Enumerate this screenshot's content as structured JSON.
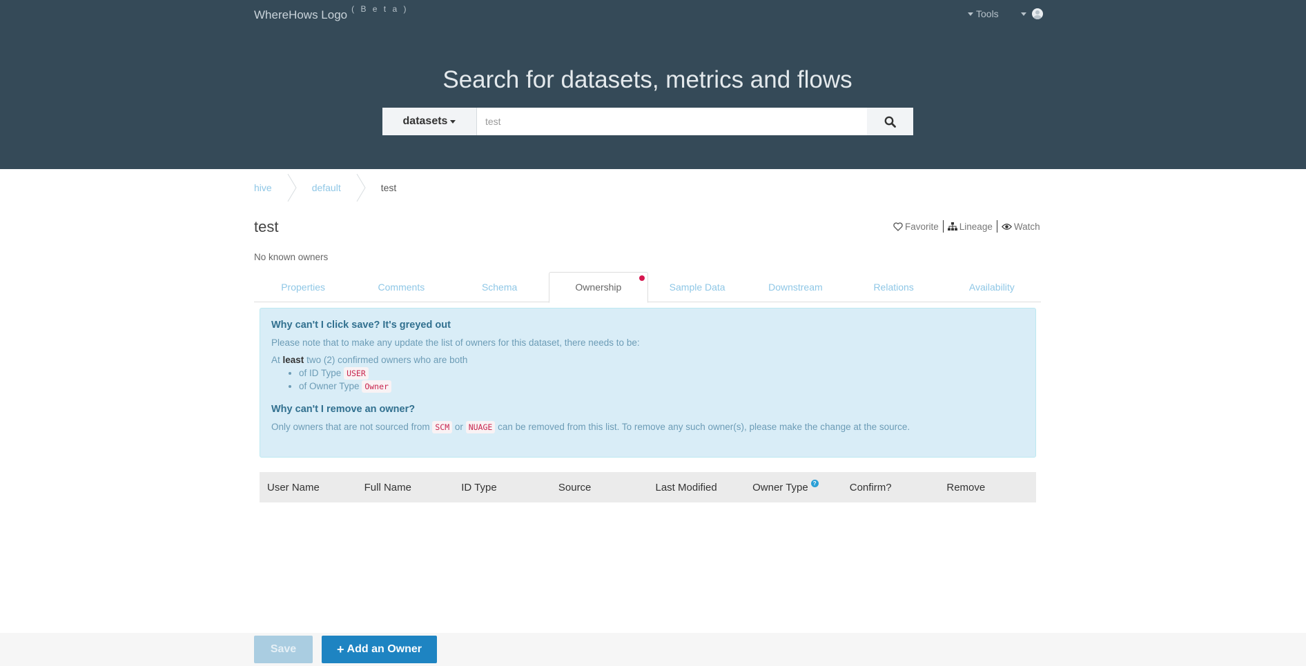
{
  "header": {
    "logo": "WhereHows Logo",
    "beta": "( B e t a )",
    "tools_label": "Tools"
  },
  "hero": {
    "title": "Search for datasets, metrics and flows",
    "search_category": "datasets",
    "search_value": "test"
  },
  "breadcrumb": [
    "hive",
    "default",
    "test"
  ],
  "dataset": {
    "title": "test",
    "owners_text": "No known owners"
  },
  "actions": {
    "favorite": "Favorite",
    "lineage": "Lineage",
    "watch": "Watch"
  },
  "tabs": [
    {
      "label": "Properties"
    },
    {
      "label": "Comments"
    },
    {
      "label": "Schema"
    },
    {
      "label": "Ownership",
      "active": true
    },
    {
      "label": "Sample Data"
    },
    {
      "label": "Downstream"
    },
    {
      "label": "Relations"
    },
    {
      "label": "Availability"
    }
  ],
  "alert": {
    "q1": "Why can't I click save? It's greyed out",
    "note": "Please note that to make any update the list of owners for this dataset, there needs to be:",
    "at": "At",
    "least": "least",
    "two_confirmed": "two (2) confirmed owners who are both",
    "id_type_prefix": "of ID Type",
    "id_type_code": "USER",
    "owner_type_prefix": "of Owner Type",
    "owner_type_code": "Owner",
    "q2": "Why can't I remove an owner?",
    "remove_prefix": "Only owners that are not sourced from",
    "code_scm": "SCM",
    "or": "or",
    "code_nuage": "NUAGE",
    "remove_suffix": "can be removed from this list. To remove any such owner(s), please make the change at the source."
  },
  "table": {
    "columns": [
      "User Name",
      "Full Name",
      "ID Type",
      "Source",
      "Last Modified",
      "Owner Type",
      "Confirm?",
      "Remove"
    ],
    "help_glyph": "?"
  },
  "footer": {
    "save_label": "Save",
    "add_label": "Add an Owner",
    "add_icon": "+"
  },
  "colors": {
    "header_bg": "#354a58",
    "link": "#8fc7e6",
    "alert_bg": "#d9edf7",
    "primary_button": "#1e84c2",
    "tab_indicator": "#d6174f"
  }
}
